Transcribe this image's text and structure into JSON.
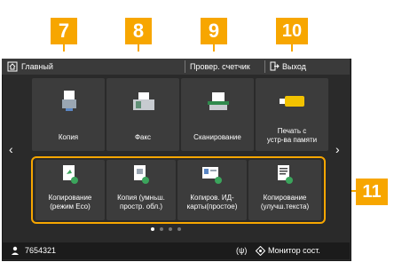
{
  "callouts": [
    "7",
    "8",
    "9",
    "10",
    "11"
  ],
  "header": {
    "home_label": "Главный",
    "counter_label": "Провер. счетчик",
    "logout_label": "Выход"
  },
  "top_tiles": [
    {
      "label": "Копия",
      "icon": "copy-icon"
    },
    {
      "label": "Факс",
      "icon": "fax-icon"
    },
    {
      "label": "Сканирование",
      "icon": "scan-icon"
    },
    {
      "label_line1": "Печать с",
      "label_line2": "устр-ва памяти",
      "icon": "usb-memory-icon"
    }
  ],
  "bottom_tiles": [
    {
      "label_line1": "Копирование",
      "label_line2": "(режим Eco)",
      "icon": "eco-copy-icon"
    },
    {
      "label_line1": "Копия (умньш.",
      "label_line2": "простр. обл.)",
      "icon": "reduced-copy-icon"
    },
    {
      "label_line1": "Копиров. ИД-",
      "label_line2": "карты(простое)",
      "icon": "id-card-copy-icon"
    },
    {
      "label_line1": "Копирование",
      "label_line2": "(улучш.текста)",
      "icon": "text-copy-icon"
    }
  ],
  "status": {
    "user_id": "7654321",
    "wireless": "(ψ)",
    "monitor_label": "Монитор сост."
  },
  "page_indicator": {
    "pages": 4,
    "current": 1
  },
  "colors": {
    "accent": "#f7a600",
    "screen": "#2a2a2a",
    "tile": "#3c3c3c"
  }
}
